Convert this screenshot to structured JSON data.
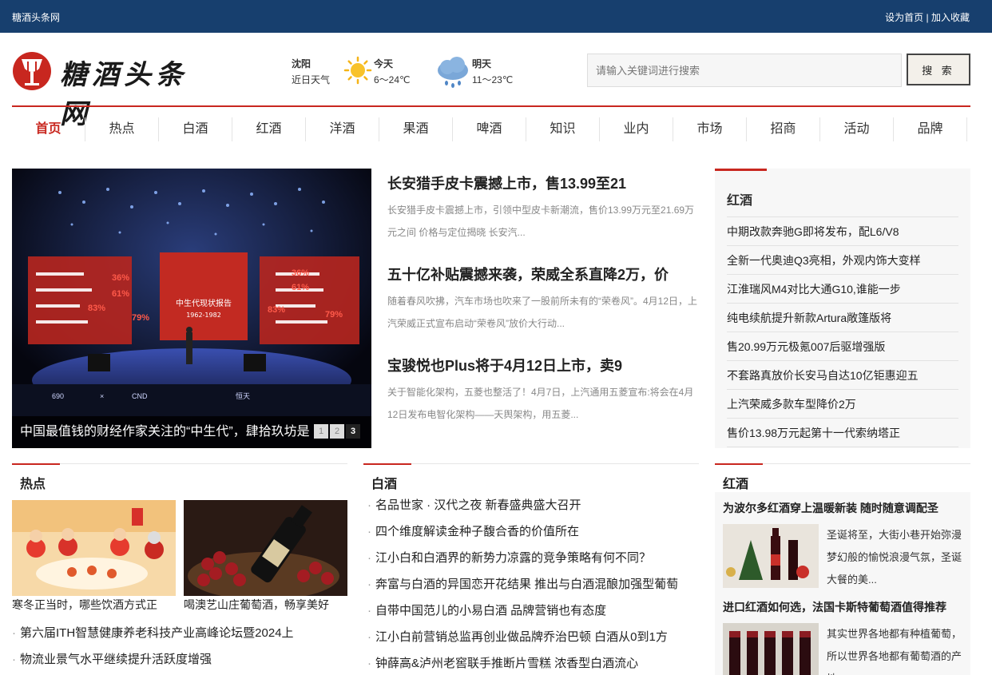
{
  "topbar": {
    "site_name": "糖酒头条网",
    "set_home": "设为首页",
    "separator": "|",
    "bookmark": "加入收藏"
  },
  "logo": {
    "text": "糖酒头条网"
  },
  "weather": {
    "city": "沈阳",
    "label": "近日天气",
    "today": {
      "day": "今天",
      "temp": "6～24℃",
      "icon": "sun-icon"
    },
    "tomorrow": {
      "day": "明天",
      "temp": "11～23℃",
      "icon": "rain-cloud-icon"
    }
  },
  "search": {
    "placeholder": "请输入关键词进行搜索",
    "button": "搜 索"
  },
  "nav": [
    "首页",
    "热点",
    "白酒",
    "红酒",
    "洋酒",
    "果酒",
    "啤酒",
    "知识",
    "业内",
    "市场",
    "招商",
    "活动",
    "品牌"
  ],
  "slider": {
    "caption": "中国最值钱的财经作家关注的“中生代”，肆拾玖坊是",
    "stage_text": "中生代现状报告",
    "stage_sub": "1962-1982",
    "pages": [
      "1",
      "2",
      "3"
    ],
    "active_page": "3"
  },
  "headlines": [
    {
      "title": "长安猎手皮卡震撼上市，售13.99至21",
      "summary": "长安猎手皮卡震撼上市，引领中型皮卡新潮流，售价13.99万元至21.69万元之间 价格与定位揭晓 长安汽..."
    },
    {
      "title": "五十亿补贴震撼来袭，荣威全系直降2万，价",
      "summary": "随着春风吹拂，汽车市场也吹来了一股前所未有的“荣卷风”。4月12日，上汽荣威正式宣布启动“荣卷风”放价大行动..."
    },
    {
      "title": "宝骏悦也Plus将于4月12日上市，卖9",
      "summary": "关于智能化架构，五菱也整活了！4月7日，上汽通用五菱宣布:将会在4月12日发布电智化架构——天舆架构，用五菱..."
    }
  ],
  "side_box": {
    "title": "红酒",
    "items": [
      "中期改款奔驰G即将发布，配L6/V8",
      "全新一代奥迪Q3亮相，外观内饰大变样",
      "江淮瑞风M4对比大通G10,谁能一步",
      "纯电续航提升新款Artura敞篷版将",
      "售20.99万元极氪007后驱增强版",
      "不套路真放价长安马自达10亿钜惠迎五",
      "上汽荣威多款车型降价2万",
      "售价13.98万元起第十一代索纳塔正"
    ]
  },
  "hot": {
    "title": "热点",
    "pics": [
      {
        "caption": "寒冬正当时，哪些饮酒方式正"
      },
      {
        "caption": "喝澳艺山庄葡萄酒，畅享美好"
      }
    ],
    "items": [
      "第六届ITH智慧健康养老科技产业高峰论坛暨2024上",
      "物流业景气水平继续提升活跃度增强"
    ]
  },
  "baijiu": {
    "title": "白酒",
    "items": [
      "名品世家 · 汉代之夜 新春盛典盛大召开",
      "四个维度解读金种子馥合香的价值所在",
      "江小白和白酒界的新势力凉露的竞争策略有何不同？",
      "奔富与白酒的异国恋开花结果 推出与白酒混酿加强型葡萄",
      "自带中国范儿的小易白酒 品牌营销也有态度",
      "江小白前营销总监再创业做品牌乔治巴顿 白酒从0到1方",
      "钟薛高&泸州老窖联手推断片雪糕 浓香型白酒流心"
    ]
  },
  "hongjiu": {
    "title": "红酒",
    "items": [
      {
        "title": "为波尔多红酒穿上温暖新装 随时随意调配圣",
        "summary": "圣诞将至，大街小巷开始弥漫梦幻般的愉悦浪漫气氛，圣诞大餐的美..."
      },
      {
        "title": "进口红酒如何选，法国卡斯特葡萄酒值得推荐",
        "summary": "其实世界各地都有种植葡萄，所以世界各地都有葡萄酒的产地，..."
      }
    ]
  },
  "colors": {
    "topbar": "#173f6e",
    "accent": "#c8271f"
  }
}
